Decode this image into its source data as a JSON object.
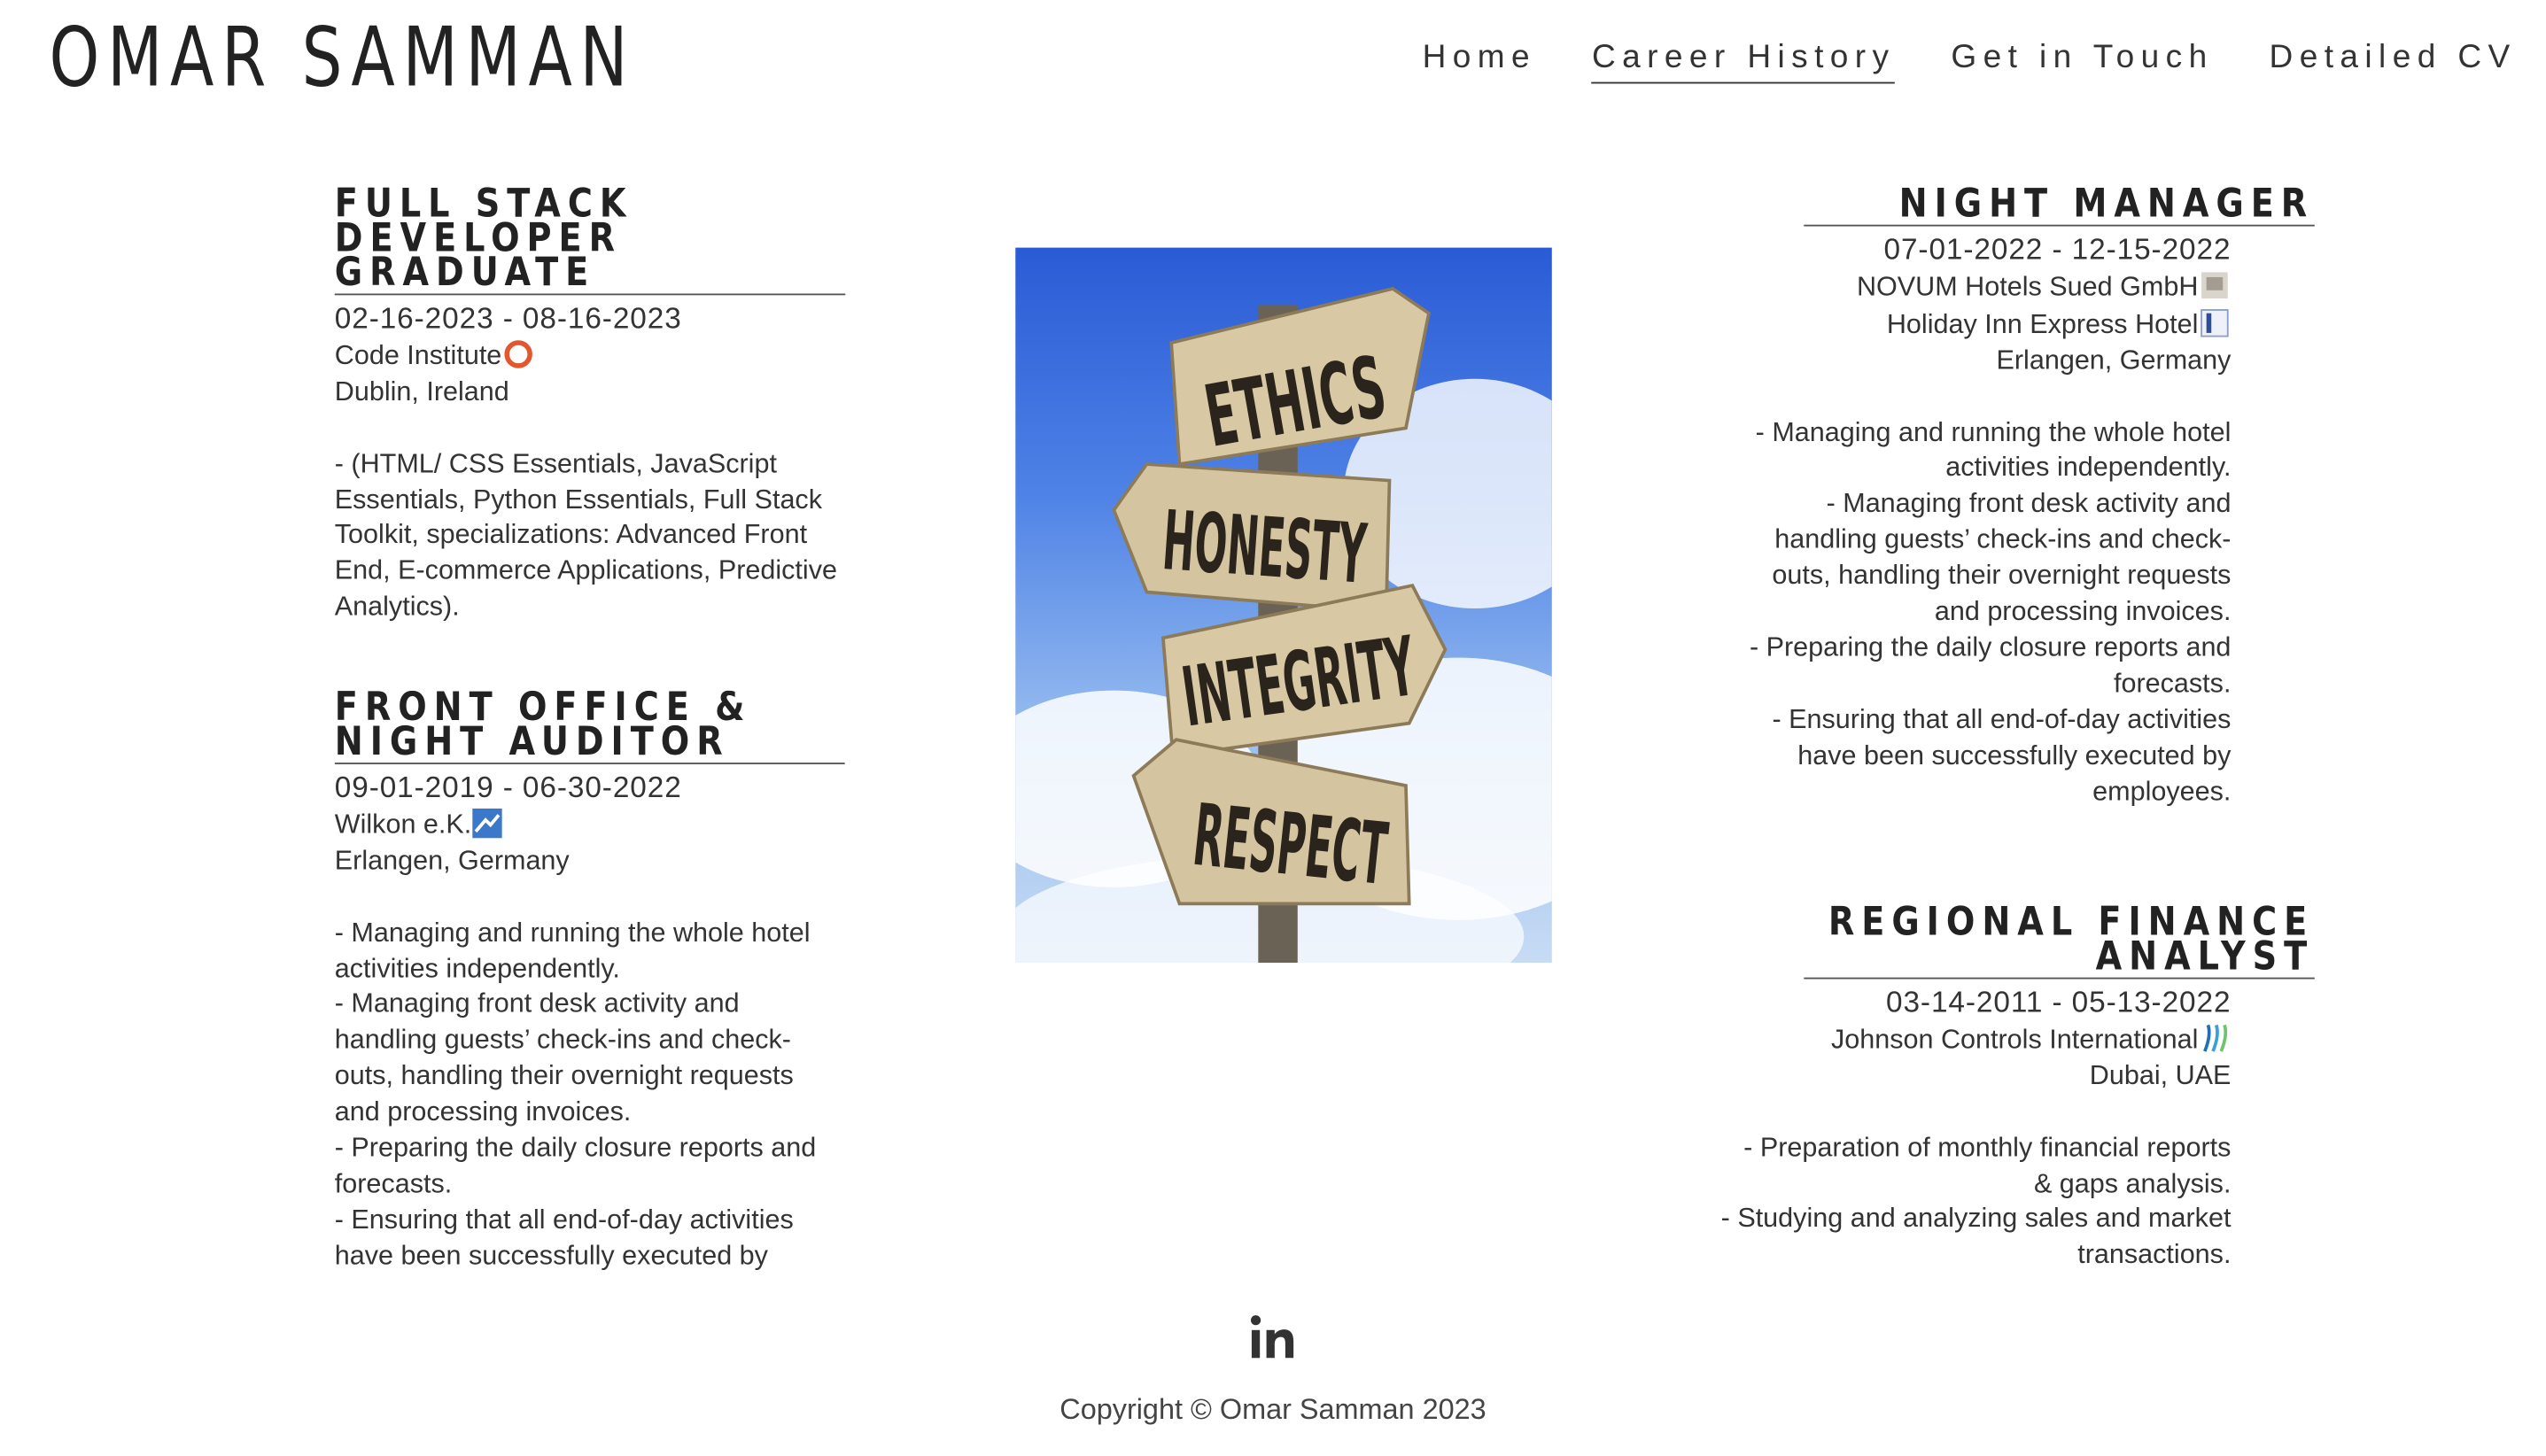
{
  "site": {
    "brand": "OMAR SAMMAN"
  },
  "nav": {
    "items": [
      {
        "label": "Home"
      },
      {
        "label": "Career History"
      },
      {
        "label": "Get in Touch"
      },
      {
        "label": "Detailed CV"
      }
    ],
    "active": "Career History"
  },
  "left_column": [
    {
      "title": "FULL STACK DEVELOPER GRADUATE",
      "dates": "02-16-2023 - 08-16-2023",
      "company": "Code Institute",
      "company_logo": "code-institute-logo",
      "location": "Dublin, Ireland",
      "description": [
        "- (HTML/ CSS Essentials, JavaScript Essentials, Python Essentials, Full Stack Toolkit, specializations: Advanced Front End, E-commerce Applications, Predictive Analytics)."
      ]
    },
    {
      "title": "FRONT OFFICE & NIGHT AUDITOR",
      "dates": "09-01-2019 - 06-30-2022",
      "company": "Wilkon e.K.",
      "company_logo": "wilkon-logo",
      "location": "Erlangen, Germany",
      "description": [
        "- Managing and running the whole hotel activities independently.",
        "- Managing front desk activity and handling guests’ check-ins and check-outs, handling their overnight requests and processing invoices.",
        "- Preparing the daily closure reports and forecasts.",
        "- Ensuring that all end-of-day activities have been successfully executed by"
      ]
    }
  ],
  "right_column": [
    {
      "title": "NIGHT MANAGER",
      "dates": "07-01-2022 - 12-15-2022",
      "companies": [
        {
          "name": "NOVUM Hotels Sued GmbH",
          "logo": "novum-logo"
        },
        {
          "name": "Holiday Inn Express Hotel",
          "logo": "holiday-inn-express-logo"
        }
      ],
      "location": "Erlangen, Germany",
      "description": [
        "- Managing and running the whole hotel activities independently.",
        "- Managing front desk activity and handling guests’ check-ins and check-outs, handling their overnight requests and processing invoices.",
        "- Preparing the daily closure reports and forecasts.",
        "- Ensuring that all end-of-day activities have been successfully executed by employees."
      ]
    },
    {
      "title": "REGIONAL FINANCE ANALYST",
      "dates": "03-14-2011 - 05-13-2022",
      "companies": [
        {
          "name": "Johnson Controls International",
          "logo": "johnson-controls-logo"
        }
      ],
      "location": "Dubai, UAE",
      "description": [
        "- Preparation of monthly financial reports & gaps analysis.",
        "- Studying and analyzing sales and market transactions."
      ]
    }
  ],
  "image": {
    "signs": [
      "ETHICS",
      "HONESTY",
      "INTEGRITY",
      "RESPECT"
    ]
  },
  "footer": {
    "social_icon": "linkedin-icon",
    "copyright": "Copyright © Omar Samman 2023"
  },
  "colors": {
    "text": "#333333",
    "heading": "#222222",
    "code_institute_accent": "#e4572e",
    "sky": "#2a5bd6"
  }
}
